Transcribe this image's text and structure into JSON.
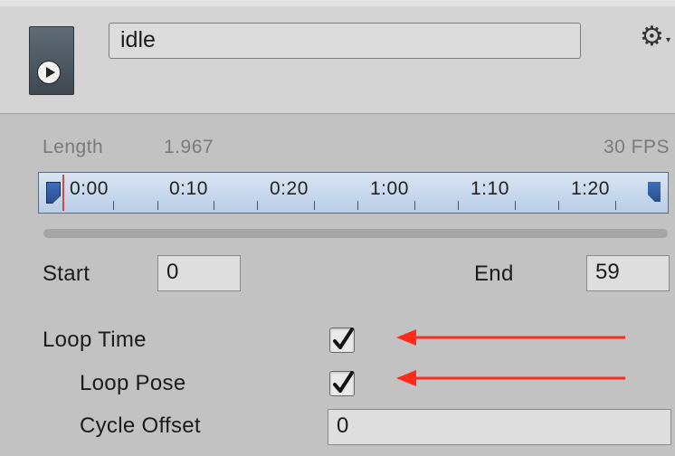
{
  "clip": {
    "name": "idle",
    "icon": "animation-clip-icon"
  },
  "header": {
    "settings_icon": "gear-icon"
  },
  "timing": {
    "length_label": "Length",
    "length_value": "1.967",
    "fps_label": "30 FPS"
  },
  "timeline": {
    "ticks": [
      "0:00",
      "0:10",
      "0:20",
      "1:00",
      "1:10",
      "1:20"
    ]
  },
  "range": {
    "start_label": "Start",
    "start_value": "0",
    "end_label": "End",
    "end_value": "59"
  },
  "options": {
    "loop_time_label": "Loop Time",
    "loop_time_checked": true,
    "loop_pose_label": "Loop Pose",
    "loop_pose_checked": true,
    "cycle_offset_label": "Cycle Offset",
    "cycle_offset_value": "0"
  },
  "annotations": {
    "arrow_color": "#ff2a1a"
  }
}
